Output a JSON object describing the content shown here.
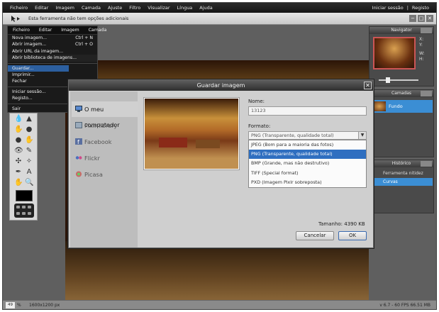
{
  "menubar": {
    "items": [
      "Ficheiro",
      "Editar",
      "Imagem",
      "Camada",
      "Ajuste",
      "Filtro",
      "Visualizar",
      "Língua",
      "Ajuda"
    ],
    "login": "Iniciar sessão",
    "separator": "|",
    "register": "Registo"
  },
  "options_bar": {
    "message": "Esta ferramenta não tem opções adicionais",
    "tool_icon": "move-tool-icon",
    "window_buttons": [
      "−",
      "□",
      "✕"
    ]
  },
  "file_menu": {
    "header": [
      "Ficheiro",
      "Editar",
      "Imagem",
      "Camada"
    ],
    "items": [
      {
        "label": "Nova imagem...",
        "shortcut": "Ctrl + N"
      },
      {
        "label": "Abrir imagem...",
        "shortcut": "Ctrl + O"
      },
      {
        "label": "Abrir URL da imagem...",
        "shortcut": ""
      },
      {
        "label": "Abrir biblioteca de imagens...",
        "shortcut": ""
      },
      {
        "label": "Guardar...",
        "shortcut": ""
      },
      {
        "label": "Imprimir...",
        "shortcut": ""
      },
      {
        "label": "Fechar",
        "shortcut": ""
      },
      {
        "label": "Iniciar sessão...",
        "shortcut": ""
      },
      {
        "label": "Registo...",
        "shortcut": ""
      },
      {
        "label": "Sair",
        "shortcut": ""
      }
    ]
  },
  "navigator": {
    "title": "Navigator",
    "x_label": "X:",
    "y_label": "Y:",
    "w_label": "W:",
    "h_label": "H:"
  },
  "layers": {
    "title": "Camadas",
    "layer_name": "Fundo"
  },
  "history": {
    "title": "Histórico",
    "items": [
      {
        "label": "Ferramenta nitidez",
        "selected": false
      },
      {
        "label": "Curvas",
        "selected": true
      }
    ]
  },
  "dialog": {
    "title": "Guardar imagem",
    "close": "✕",
    "sources": [
      {
        "label": "O meu computador",
        "active": true,
        "icon": "computer-icon"
      },
      {
        "label": "Pixlr library",
        "active": false,
        "icon": "library-icon"
      },
      {
        "label": "Facebook",
        "active": false,
        "icon": "facebook-icon"
      },
      {
        "label": "Flickr",
        "active": false,
        "icon": "flickr-icon"
      },
      {
        "label": "Picasa",
        "active": false,
        "icon": "picasa-icon"
      }
    ],
    "name_label": "Nome:",
    "name_value": "13123",
    "format_label": "Formato:",
    "format_value": "PNG (Transparente, qualidade total)",
    "format_options": [
      {
        "label": "JPEG (Bom para a maioria das fotos)",
        "selected": false
      },
      {
        "label": "PNG (Transparente, qualidade total)",
        "selected": true
      },
      {
        "label": "BMP (Grande, mas não destrutivo)",
        "selected": false
      },
      {
        "label": "TIFF (Special format)",
        "selected": false
      },
      {
        "label": "PXD (Imagem Pixlr sobreposta)",
        "selected": false
      }
    ],
    "size_text": "Tamanho: 4390 KB",
    "cancel": "Cancelar",
    "ok": "OK"
  },
  "status": {
    "zoom_value": "49",
    "zoom_unit": "%",
    "image_size": "1600x1200 px",
    "fps": "v 6.7 - 60 FPS 66.51 MB"
  },
  "colors": {
    "accent": "#3b8ed4",
    "selection": "#2f6fc0",
    "menu_bg": "#1a1a1a"
  }
}
